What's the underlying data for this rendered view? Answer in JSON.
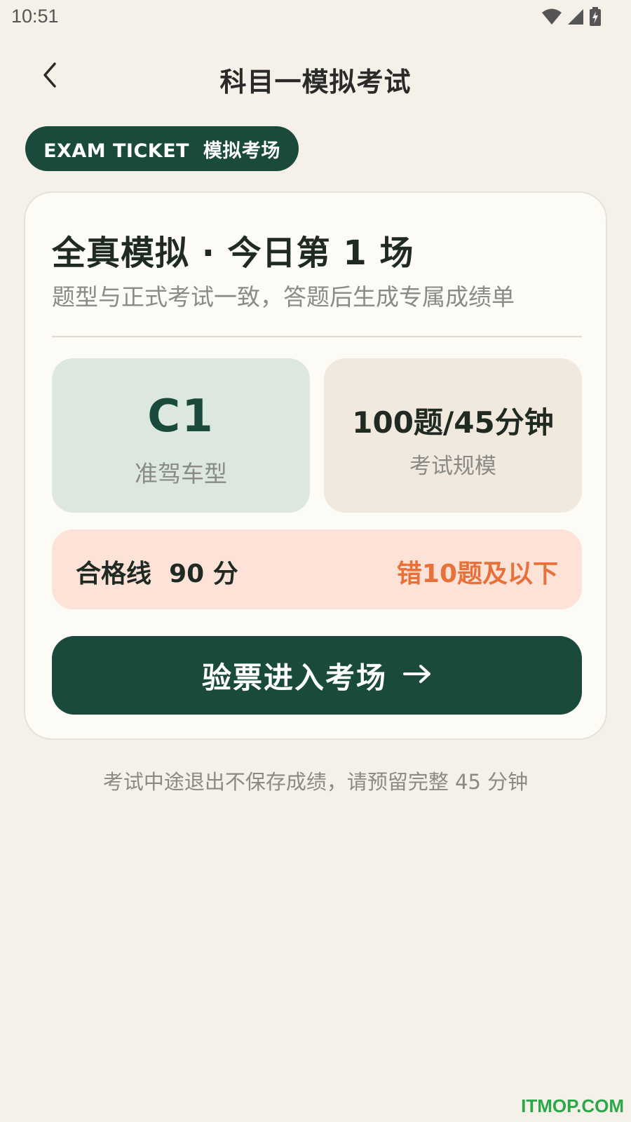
{
  "status_bar": {
    "time": "10:51",
    "icons": [
      "wifi-icon",
      "cellular-signal-icon",
      "battery-charging-icon"
    ]
  },
  "header": {
    "back_icon": "chevron-left-icon",
    "title": "科目一模拟考试"
  },
  "ticket_pill": {
    "label": "EXAM TICKET  模拟考场"
  },
  "card": {
    "title": "全真模拟 · 今日第 1 场",
    "subtitle": "题型与正式考试一致，答题后生成专属成绩单",
    "license": {
      "value": "C1",
      "label": "准驾车型"
    },
    "scale": {
      "value": "100题/45分钟",
      "label": "考试规模"
    },
    "pass": {
      "label": "合格线  90 分",
      "note": "错10题及以下"
    },
    "enter_button": {
      "label": "验票进入考场",
      "icon": "arrow-right-icon"
    }
  },
  "footnote": "考试中途退出不保存成绩，请预留完整 45 分钟",
  "watermark": "ITMOP.COM",
  "colors": {
    "background": "#f5f1e8",
    "primary": "#1a4a3c",
    "accent_orange": "#e8713a",
    "license_tile": "#dce8df",
    "scale_tile": "#f1e9de",
    "pass_row": "#fde2d8",
    "watermark": "#2aa84a"
  }
}
